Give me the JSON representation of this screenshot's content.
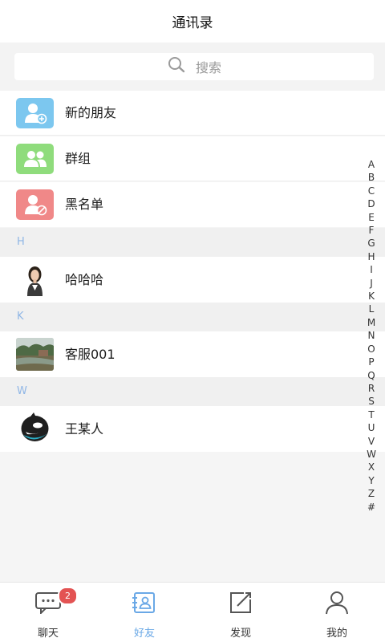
{
  "header": {
    "title": "通讯录"
  },
  "search": {
    "placeholder": "搜索",
    "icon": "search-icon"
  },
  "quick_entries": [
    {
      "label": "新的朋友",
      "icon": "add-friend-icon",
      "color": "#7cc7ef"
    },
    {
      "label": "群组",
      "icon": "group-icon",
      "color": "#8fdc7c"
    },
    {
      "label": "黑名单",
      "icon": "blacklist-icon",
      "color": "#f08888"
    }
  ],
  "sections": [
    {
      "letter": "H",
      "contacts": [
        {
          "name": "哈哈哈",
          "avatar": "woman-portrait"
        }
      ]
    },
    {
      "letter": "K",
      "contacts": [
        {
          "name": "客服001",
          "avatar": "landscape-photo"
        }
      ]
    },
    {
      "letter": "W",
      "contacts": [
        {
          "name": "王某人",
          "avatar": "orca-logo"
        }
      ]
    }
  ],
  "index_letters": [
    "A",
    "B",
    "C",
    "D",
    "E",
    "F",
    "G",
    "H",
    "I",
    "J",
    "K",
    "L",
    "M",
    "N",
    "O",
    "P",
    "Q",
    "R",
    "S",
    "T",
    "U",
    "V",
    "W",
    "X",
    "Y",
    "Z",
    "#"
  ],
  "tabs": [
    {
      "label": "聊天",
      "icon": "chat-icon",
      "badge": "2"
    },
    {
      "label": "好友",
      "icon": "contacts-icon",
      "active": true
    },
    {
      "label": "发现",
      "icon": "discover-icon"
    },
    {
      "label": "我的",
      "icon": "profile-icon"
    }
  ],
  "colors": {
    "accent": "#6aa8e6",
    "section_letter": "#8fb6e6",
    "badge": "#e35353"
  }
}
